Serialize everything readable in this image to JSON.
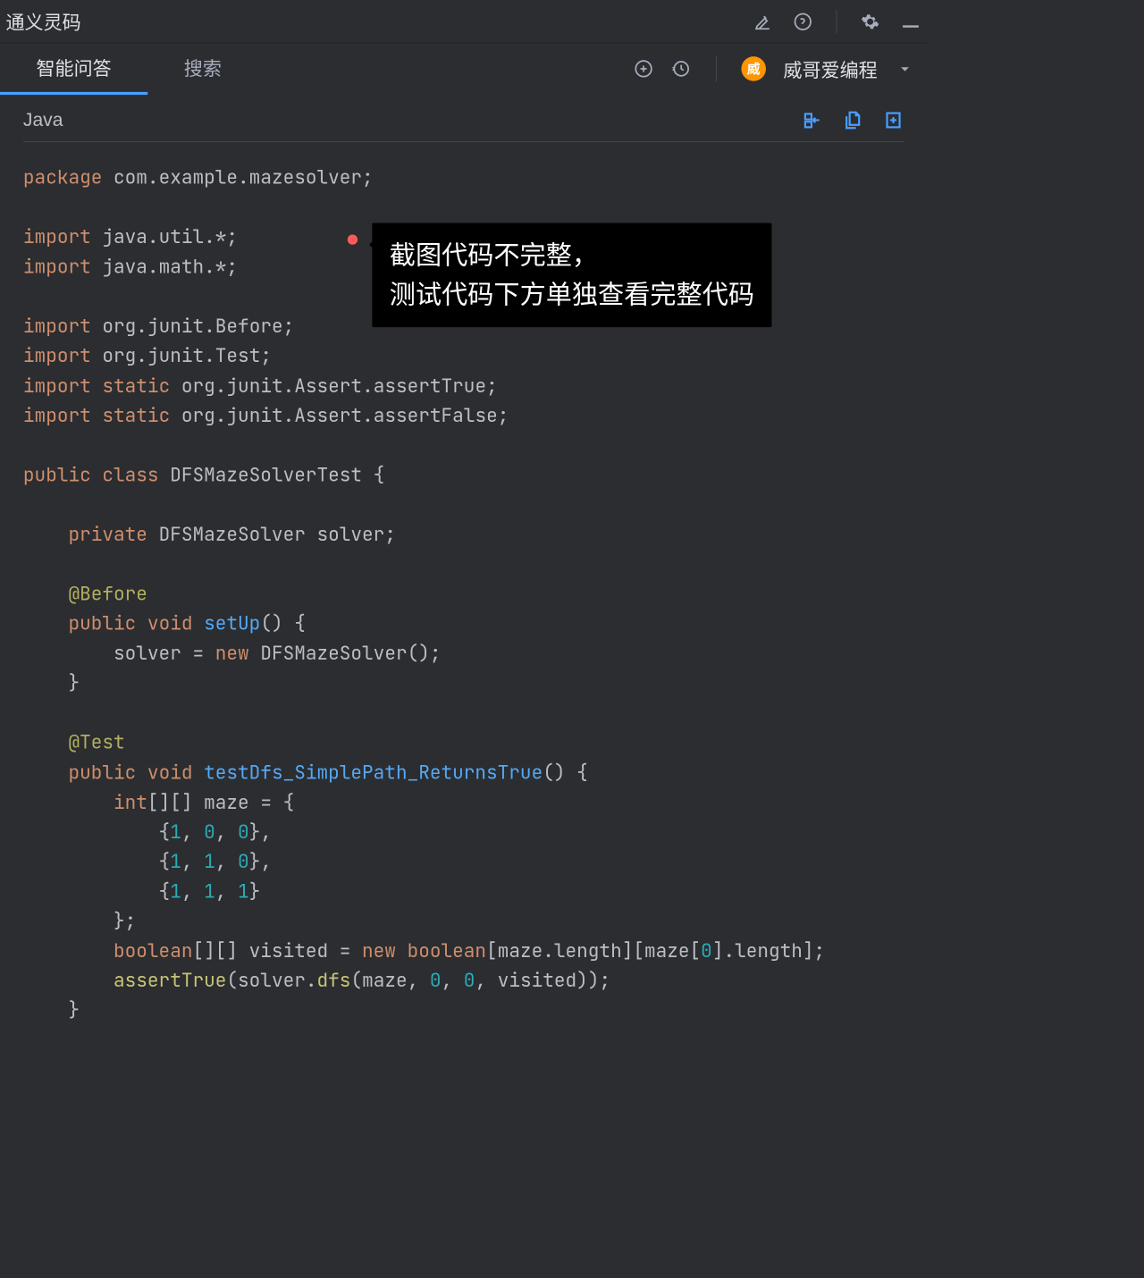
{
  "titlebar": {
    "title": "通义灵码"
  },
  "tabs": {
    "qa": "智能问答",
    "search": "搜索"
  },
  "user": {
    "avatar_char": "威",
    "name": "威哥爱编程"
  },
  "language": "Java",
  "tooltip": {
    "line1": "截图代码不完整，",
    "line2": "测试代码下方单独查看完整代码"
  },
  "code": {
    "l1_kw": "package",
    "l1_pkg1": "com",
    "l1_pkg2": "example",
    "l1_pkg3": "mazesolver",
    "l3_kw": "import",
    "l3_pkg1": "java",
    "l3_pkg2": "util",
    "l4_kw": "import",
    "l4_pkg1": "java",
    "l4_pkg2": "math",
    "l6_kw": "import",
    "l6_pkg1": "org",
    "l6_pkg2": "junit",
    "l6_pkg3": "Before",
    "l7_kw": "import",
    "l7_pkg1": "org",
    "l7_pkg2": "junit",
    "l7_pkg3": "Test",
    "l8_kw1": "import",
    "l8_kw2": "static",
    "l8_pkg1": "org",
    "l8_pkg2": "junit",
    "l8_pkg3": "Assert",
    "l8_pkg4": "assertTrue",
    "l9_kw1": "import",
    "l9_kw2": "static",
    "l9_pkg1": "org",
    "l9_pkg2": "junit",
    "l9_pkg3": "Assert",
    "l9_pkg4": "assertFalse",
    "l11_kw1": "public",
    "l11_kw2": "class",
    "l11_name": "DFSMazeSolverTest",
    "l13_kw": "private",
    "l13_type": "DFSMazeSolver",
    "l13_var": "solver",
    "l15_ann": "@Before",
    "l16_kw1": "public",
    "l16_kw2": "void",
    "l16_fn": "setUp",
    "l17_var": "solver",
    "l17_kw": "new",
    "l17_type": "DFSMazeSolver",
    "l20_ann": "@Test",
    "l21_kw1": "public",
    "l21_kw2": "void",
    "l21_fn": "testDfs_SimplePath_ReturnsTrue",
    "l22_kw": "int",
    "l22_var": "maze",
    "l23_n1": "1",
    "l23_n2": "0",
    "l23_n3": "0",
    "l24_n1": "1",
    "l24_n2": "1",
    "l24_n3": "0",
    "l25_n1": "1",
    "l25_n2": "1",
    "l25_n3": "1",
    "l27_kw1": "boolean",
    "l27_var": "visited",
    "l27_kw2": "new",
    "l27_kw3": "boolean",
    "l27_m1": "maze",
    "l27_m2": "length",
    "l27_m3": "maze",
    "l27_n0": "0",
    "l27_m4": "length",
    "l28_fn": "assertTrue",
    "l28_var": "solver",
    "l28_m": "dfs",
    "l28_arg1": "maze",
    "l28_n1": "0",
    "l28_n2": "0",
    "l28_arg2": "visited"
  }
}
